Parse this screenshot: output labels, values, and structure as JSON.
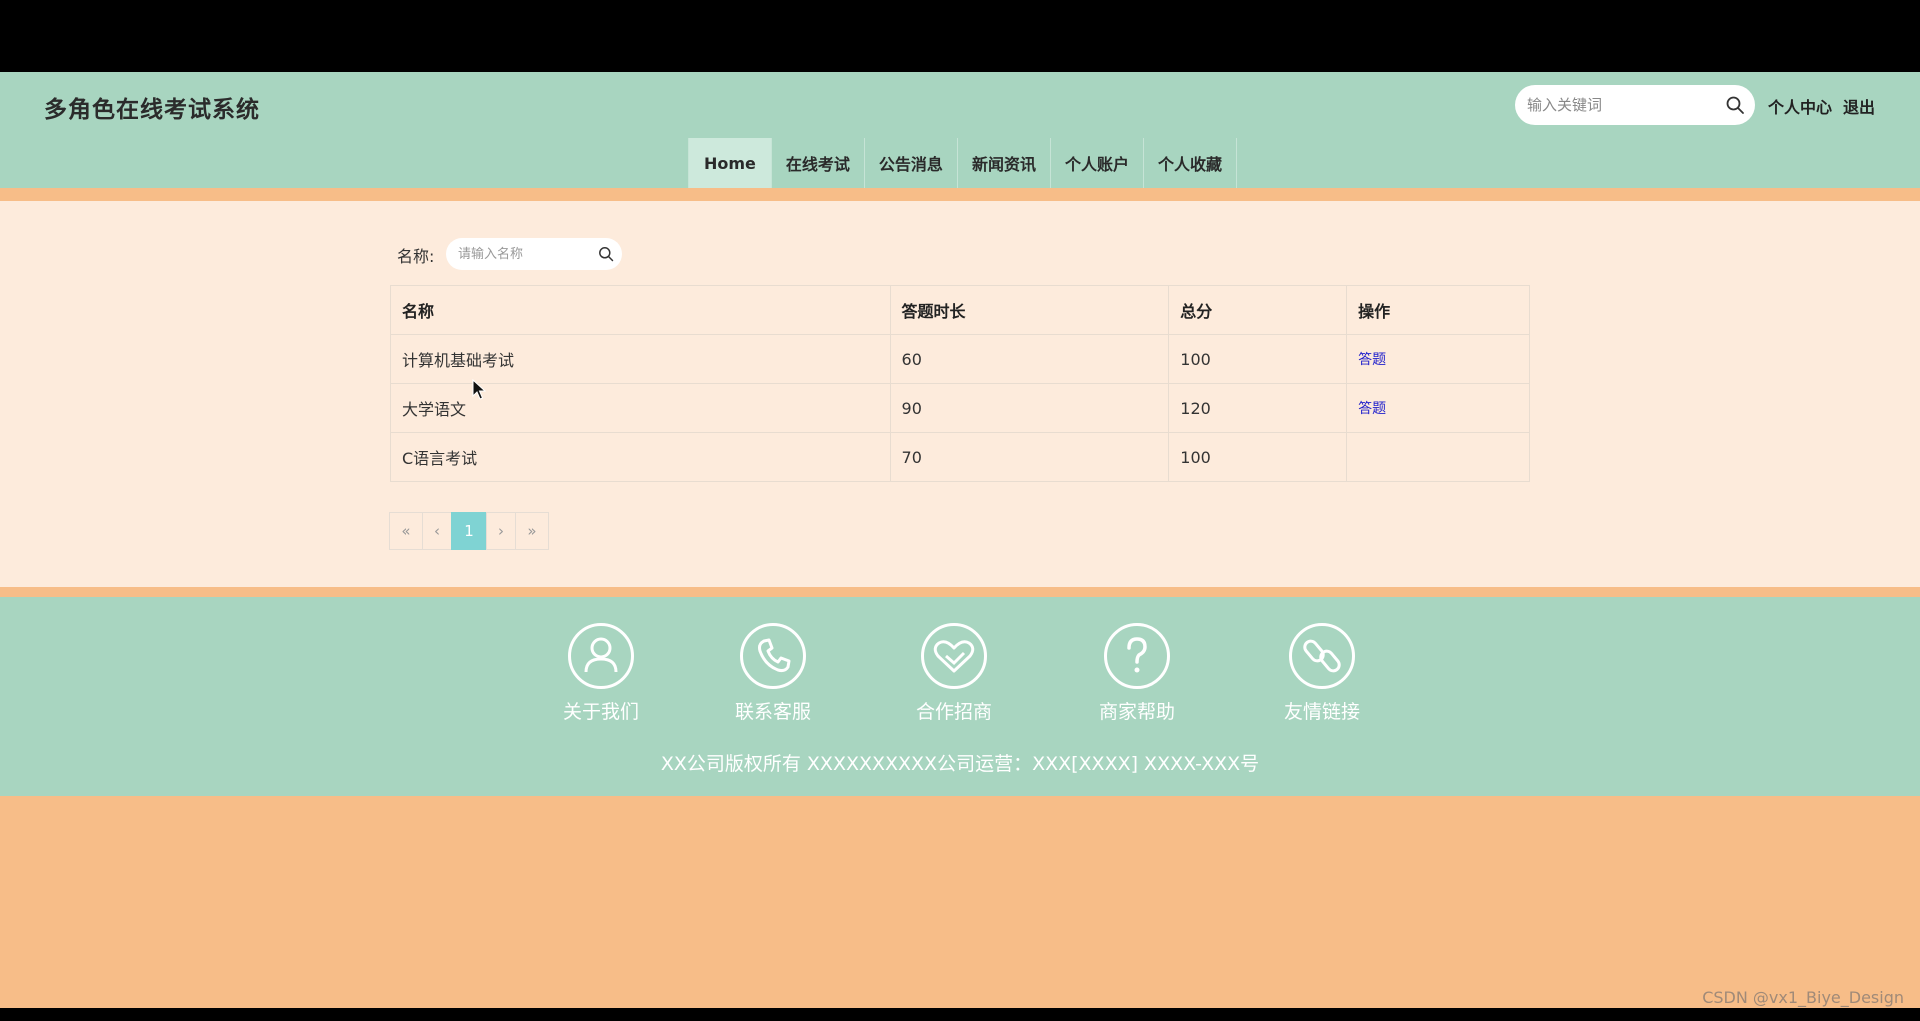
{
  "header": {
    "site_title": "多角色在线考试系统",
    "search_placeholder": "输入关键词",
    "personal_center": "个人中心",
    "logout": "退出"
  },
  "nav": {
    "items": [
      "Home",
      "在线考试",
      "公告消息",
      "新闻资讯",
      "个人账户",
      "个人收藏"
    ],
    "active": "Home"
  },
  "filter": {
    "label": "名称:",
    "placeholder": "请输入名称"
  },
  "table": {
    "columns": [
      "名称",
      "答题时长",
      "总分",
      "操作"
    ],
    "rows": [
      {
        "name": "计算机基础考试",
        "duration": "60",
        "score": "100",
        "action": "答题"
      },
      {
        "name": "大学语文",
        "duration": "90",
        "score": "120",
        "action": "答题"
      },
      {
        "name": "C语言考试",
        "duration": "70",
        "score": "100",
        "action": ""
      }
    ]
  },
  "pagination": {
    "first": "«",
    "prev": "‹",
    "current": "1",
    "next": "›",
    "last": "»"
  },
  "footer": {
    "items": [
      {
        "label": "关于我们",
        "icon": "user-icon"
      },
      {
        "label": "联系客服",
        "icon": "phone-icon"
      },
      {
        "label": "合作招商",
        "icon": "handshake-heart-icon"
      },
      {
        "label": "商家帮助",
        "icon": "question-icon"
      },
      {
        "label": "友情链接",
        "icon": "link-icon"
      }
    ],
    "copyright": "XX公司版权所有 XXXXXXXXXX公司运营：XXX[XXXX] XXXX-XXX号"
  },
  "watermark": "CSDN @vx1_Biye_Design",
  "colors": {
    "header_bg": "#a8d5c0",
    "content_bg": "#fdebdc",
    "accent_orange": "#f7bd88",
    "pager_active": "#7fd3d3",
    "link": "#2222cc"
  }
}
